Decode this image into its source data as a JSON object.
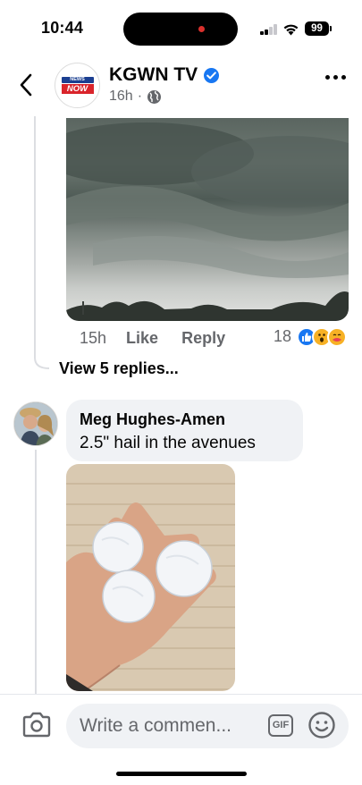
{
  "status_bar": {
    "time": "10:44",
    "battery": "99"
  },
  "header": {
    "page_name": "KGWN TV",
    "post_age": "16h",
    "meta_separator": "·",
    "logo_top_text": "NEWS",
    "logo_bottom_text": "NOW",
    "verified": true
  },
  "comment_1": {
    "image_icon": "storm-cloud-photo",
    "time": "15h",
    "like_label": "Like",
    "reply_label": "Reply",
    "reaction_count": "18",
    "reactions": [
      "like",
      "wow",
      "care"
    ],
    "view_replies_label": "View 5 replies..."
  },
  "comment_2": {
    "author": "Meg Hughes-Amen",
    "text": "2.5\" hail in the avenues",
    "image_icon": "hail-in-hand-photo"
  },
  "composer": {
    "placeholder": "Write a commen...",
    "gif_label": "GIF"
  },
  "colors": {
    "accent": "#1877f2",
    "secondary_text": "#65676b",
    "bubble": "#f0f2f5"
  }
}
